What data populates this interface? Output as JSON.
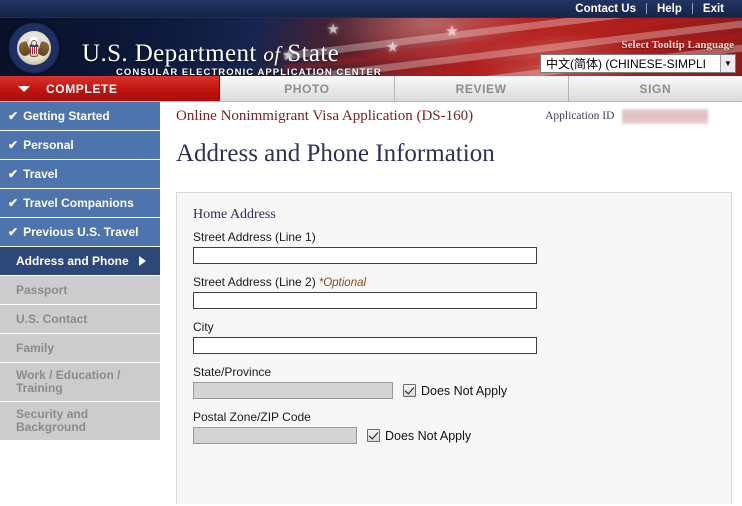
{
  "utility": {
    "links": [
      {
        "label": "Contact Us"
      },
      {
        "label": "Help"
      },
      {
        "label": "Exit"
      }
    ]
  },
  "banner": {
    "seal_name": "great-seal-of-the-united-states",
    "title_us": "U.S.",
    "title_department": "Department",
    "title_of": "of",
    "title_state": "State",
    "subtitle": "CONSULAR ELECTRONIC APPLICATION CENTER",
    "tooltip_language_label": "Select Tooltip Language",
    "language_selected": "中文(简体)  (CHINESE-SIMPLI"
  },
  "steps": [
    {
      "label": "COMPLETE",
      "state": "active"
    },
    {
      "label": "PHOTO",
      "state": "inactive"
    },
    {
      "label": "REVIEW",
      "state": "inactive"
    },
    {
      "label": "SIGN",
      "state": "inactive"
    }
  ],
  "appbar": {
    "application_title": "Online Nonimmigrant Visa Application (DS-160)",
    "application_id_label": "Application ID",
    "application_id_value": ""
  },
  "sidebar": {
    "items": [
      {
        "label": "Getting Started",
        "state": "completed",
        "check": "✔"
      },
      {
        "label": "Personal",
        "state": "completed",
        "check": "✔"
      },
      {
        "label": "Travel",
        "state": "completed",
        "check": "✔"
      },
      {
        "label": "Travel Companions",
        "state": "completed",
        "check": "✔"
      },
      {
        "label": "Previous U.S. Travel",
        "state": "completed",
        "check": "✔"
      },
      {
        "label": "Address and Phone",
        "state": "current",
        "check": ""
      },
      {
        "label": "Passport",
        "state": "disabled",
        "check": ""
      },
      {
        "label": "U.S. Contact",
        "state": "disabled",
        "check": ""
      },
      {
        "label": "Family",
        "state": "disabled",
        "check": ""
      },
      {
        "label": "Work / Education / Training",
        "state": "disabled",
        "check": ""
      },
      {
        "label": "Security and Background",
        "state": "disabled",
        "check": ""
      }
    ]
  },
  "main": {
    "page_title": "Address and Phone Information",
    "group_heading": "Home Address",
    "fields": [
      {
        "label": "Street Address (Line 1)",
        "optional_note": "",
        "value": "",
        "disabled": false,
        "has_does_not_apply": false,
        "does_not_apply_checked": false
      },
      {
        "label": "Street Address (Line 2)",
        "optional_note": "*Optional",
        "value": "",
        "disabled": false,
        "has_does_not_apply": false,
        "does_not_apply_checked": false
      },
      {
        "label": "City",
        "optional_note": "",
        "value": "",
        "disabled": false,
        "has_does_not_apply": false,
        "does_not_apply_checked": false
      },
      {
        "label": "State/Province",
        "optional_note": "",
        "value": "",
        "disabled": true,
        "has_does_not_apply": true,
        "does_not_apply_checked": true,
        "does_not_apply_label": "Does Not Apply"
      },
      {
        "label": "Postal Zone/ZIP Code",
        "optional_note": "",
        "value": "",
        "disabled": true,
        "has_does_not_apply": true,
        "does_not_apply_checked": true,
        "does_not_apply_label": "Does Not Apply"
      }
    ]
  },
  "colors": {
    "navy": "#1b2a52",
    "banner_red": "#b52520",
    "active_tab_red": "#c01410",
    "sidebar_blue": "#4d74ad",
    "sidebar_current": "#2d4878",
    "sidebar_disabled": "#cccccc",
    "title_maroon": "#7b2222",
    "heading_navy": "#2c3058",
    "optional_brown": "#8a4b12"
  }
}
